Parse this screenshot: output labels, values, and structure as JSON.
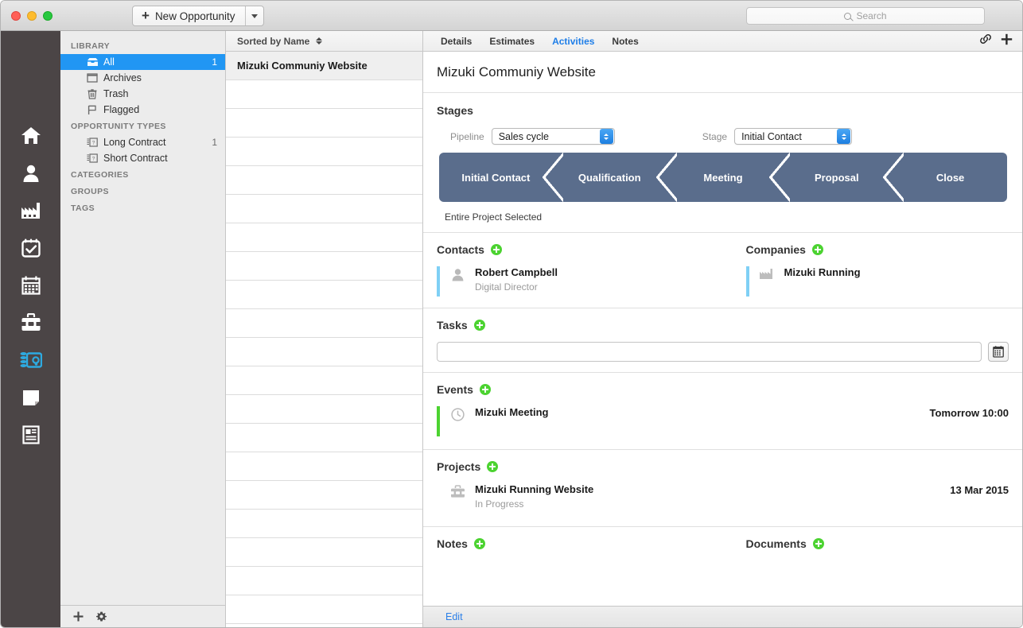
{
  "titlebar": {
    "new_button_label": "New Opportunity",
    "new_button_icon": "plus-icon",
    "dropdown_icon": "chevron-down-icon",
    "search_placeholder": "Search",
    "search_value": "",
    "search_icon": "search-icon"
  },
  "rail": {
    "items": [
      {
        "name": "home",
        "icon": "home-icon",
        "active": false
      },
      {
        "name": "contacts",
        "icon": "person-icon",
        "active": false
      },
      {
        "name": "companies",
        "icon": "factory-icon",
        "active": false
      },
      {
        "name": "tasks",
        "icon": "checklist-icon",
        "active": false
      },
      {
        "name": "calendar",
        "icon": "calendar-icon",
        "active": false
      },
      {
        "name": "projects",
        "icon": "toolbox-icon",
        "active": false
      },
      {
        "name": "opportunities",
        "icon": "opportunity-icon",
        "active": true
      },
      {
        "name": "notes",
        "icon": "note-icon",
        "active": false
      },
      {
        "name": "documents",
        "icon": "document-icon",
        "active": false
      }
    ],
    "active_color": "#2eaae0"
  },
  "sidebar": {
    "groups": [
      {
        "header": "LIBRARY",
        "items": [
          {
            "label": "All",
            "icon": "inbox-icon",
            "count": "1",
            "selected": true
          },
          {
            "label": "Archives",
            "icon": "archive-icon",
            "count": "",
            "selected": false
          },
          {
            "label": "Trash",
            "icon": "trash-icon",
            "count": "",
            "selected": false
          },
          {
            "label": "Flagged",
            "icon": "flag-icon",
            "count": "",
            "selected": false
          }
        ]
      },
      {
        "header": "OPPORTUNITY TYPES",
        "items": [
          {
            "label": "Long Contract",
            "icon": "card-icon",
            "count": "1",
            "selected": false
          },
          {
            "label": "Short Contract",
            "icon": "card-icon",
            "count": "",
            "selected": false
          }
        ]
      },
      {
        "header": "CATEGORIES",
        "items": []
      },
      {
        "header": "GROUPS",
        "items": []
      },
      {
        "header": "TAGS",
        "items": []
      }
    ],
    "bottom": {
      "add_icon": "plus-icon",
      "settings_icon": "gear-icon"
    },
    "selection_color": "#2196f3"
  },
  "list": {
    "sort_label": "Sorted by Name",
    "sort_icon": "sort-icon",
    "rows": [
      {
        "title": "Mizuki Communiy Website",
        "selected": true
      },
      {
        "title": "",
        "selected": false
      },
      {
        "title": "",
        "selected": false
      },
      {
        "title": "",
        "selected": false
      },
      {
        "title": "",
        "selected": false
      },
      {
        "title": "",
        "selected": false
      },
      {
        "title": "",
        "selected": false
      },
      {
        "title": "",
        "selected": false
      },
      {
        "title": "",
        "selected": false
      },
      {
        "title": "",
        "selected": false
      },
      {
        "title": "",
        "selected": false
      },
      {
        "title": "",
        "selected": false
      },
      {
        "title": "",
        "selected": false
      },
      {
        "title": "",
        "selected": false
      },
      {
        "title": "",
        "selected": false
      },
      {
        "title": "",
        "selected": false
      },
      {
        "title": "",
        "selected": false
      },
      {
        "title": "",
        "selected": false
      },
      {
        "title": "",
        "selected": false
      },
      {
        "title": "",
        "selected": false
      }
    ]
  },
  "detail": {
    "tabs": [
      {
        "label": "Details",
        "active": false
      },
      {
        "label": "Estimates",
        "active": false
      },
      {
        "label": "Activities",
        "active": true
      },
      {
        "label": "Notes",
        "active": false
      }
    ],
    "tab_active_color": "#1e7ee8",
    "toolbar_icons": [
      {
        "name": "link-icon"
      },
      {
        "name": "plus-icon"
      }
    ],
    "title": "Mizuki Communiy Website",
    "stages": {
      "heading": "Stages",
      "pipeline_label": "Pipeline",
      "pipeline_value": "Sales cycle",
      "stage_label": "Stage",
      "stage_value": "Initial Contact",
      "steps": [
        {
          "label": "Initial Contact"
        },
        {
          "label": "Qualification"
        },
        {
          "label": "Meeting"
        },
        {
          "label": "Proposal"
        },
        {
          "label": "Close"
        }
      ],
      "step_color": "#5a6d8c",
      "footnote": "Entire Project Selected"
    },
    "contacts": {
      "heading": "Contacts",
      "add_icon": "add-circle-icon",
      "items": [
        {
          "name": "Robert Campbell",
          "sub": "Digital Director",
          "icon": "person-icon",
          "accent": "#7fd0f5",
          "right": ""
        }
      ]
    },
    "companies": {
      "heading": "Companies",
      "add_icon": "add-circle-icon",
      "items": [
        {
          "name": "Mizuki Running",
          "sub": "",
          "icon": "factory-icon",
          "accent": "#7fd0f5",
          "right": ""
        }
      ]
    },
    "tasks": {
      "heading": "Tasks",
      "add_icon": "add-circle-icon",
      "input_value": "",
      "input_placeholder": "",
      "calendar_icon": "calendar-icon"
    },
    "events": {
      "heading": "Events",
      "add_icon": "add-circle-icon",
      "items": [
        {
          "name": "Mizuki Meeting",
          "sub": "",
          "icon": "clock-icon",
          "accent": "#4cd331",
          "right": "Tomorrow 10:00"
        }
      ]
    },
    "projects": {
      "heading": "Projects",
      "add_icon": "add-circle-icon",
      "items": [
        {
          "name": "Mizuki Running Website",
          "sub": "In Progress",
          "icon": "toolbox-icon",
          "accent": "transparent",
          "right": "13 Mar 2015"
        }
      ]
    },
    "notes": {
      "heading": "Notes",
      "add_icon": "add-circle-icon",
      "items": []
    },
    "documents": {
      "heading": "Documents",
      "add_icon": "add-circle-icon",
      "items": []
    },
    "editbar": {
      "label": "Edit"
    }
  }
}
